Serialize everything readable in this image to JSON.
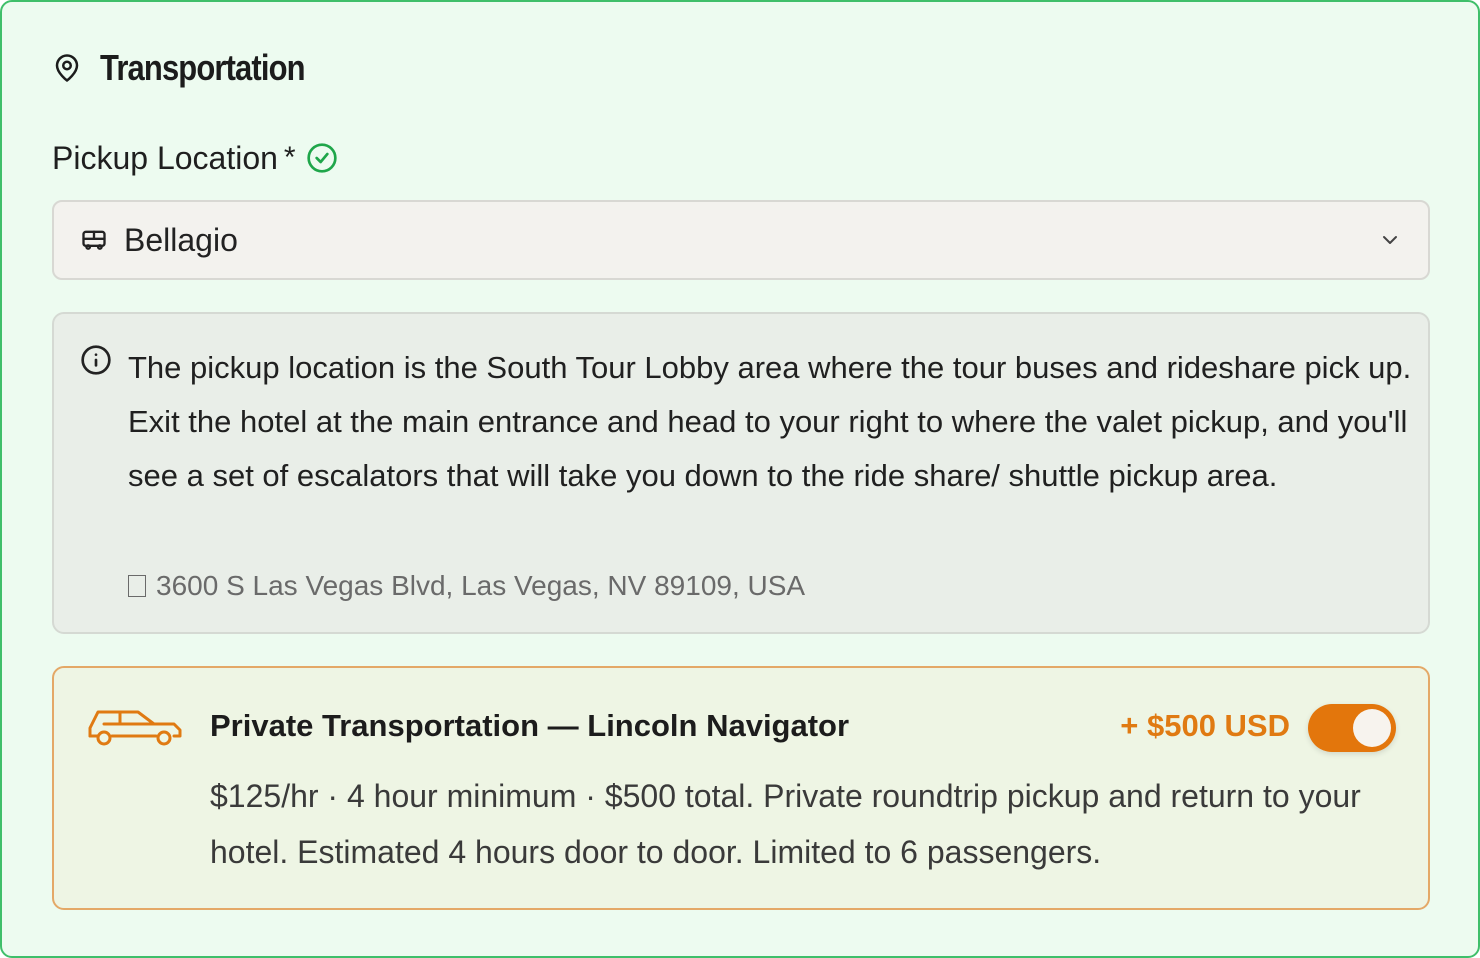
{
  "section": {
    "title": "Transportation",
    "icon": "map-pin-icon"
  },
  "pickup": {
    "label": "Pickup Location",
    "required_marker": "*",
    "valid_icon": "check-circle-icon",
    "selected_value": "Bellagio",
    "select_icon": "bus-icon",
    "dropdown_icon": "chevron-down-icon"
  },
  "info": {
    "icon": "info-icon",
    "text": "The pickup location is the South Tour Lobby area where the tour buses and rideshare pick up. Exit the hotel at the main entrance and head to your right to where the valet pickup, and you'll see a set of escalators that will take you down to the ride share/ shuttle pickup area.",
    "address": "3600 S Las Vegas Blvd, Las Vegas, NV 89109, USA"
  },
  "upsell": {
    "icon": "car-icon",
    "title": "Private Transportation — Lincoln Navigator",
    "price": "+ $500 USD",
    "toggle_on": true,
    "description": "$125/hr · 4 hour minimum · $500 total. Private roundtrip pickup and return to your hotel. Estimated 4 hours door to door. Limited to 6 passengers."
  },
  "colors": {
    "card_bg": "#edfbf0",
    "card_border": "#3fbf6a",
    "accent_orange": "#e3760c",
    "valid_green": "#1fa64a"
  }
}
